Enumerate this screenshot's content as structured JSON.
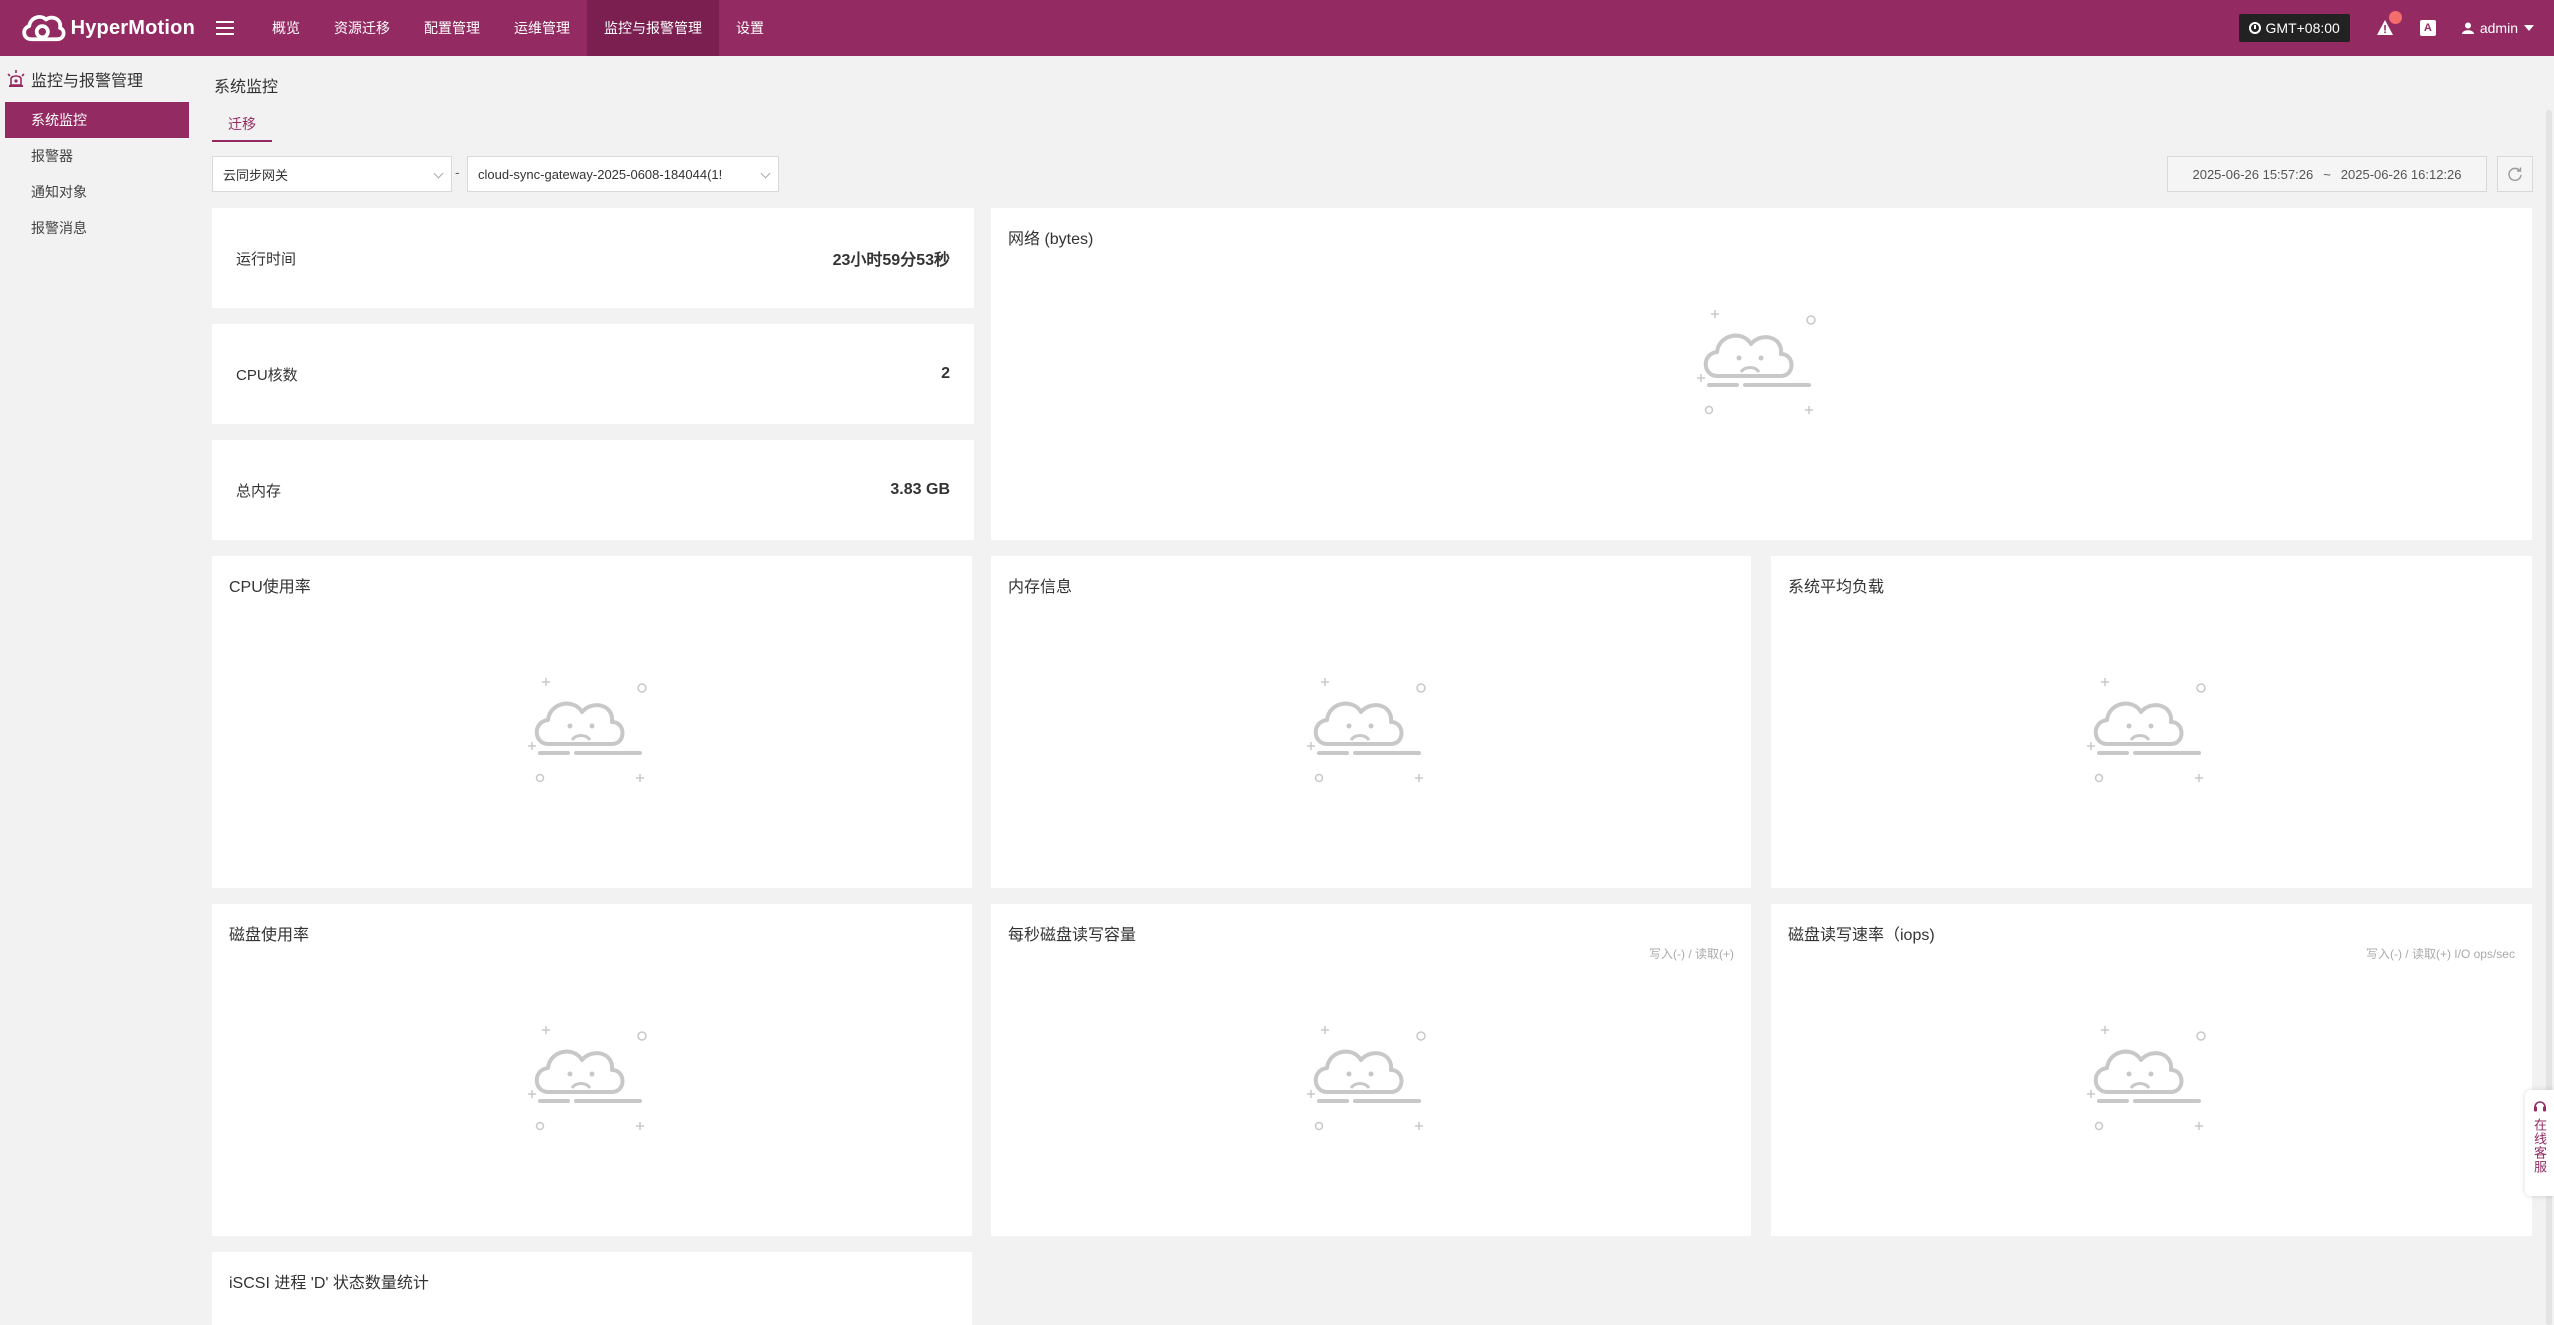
{
  "app": {
    "name": "HyperMotion"
  },
  "nav": [
    {
      "label": "概览"
    },
    {
      "label": "资源迁移"
    },
    {
      "label": "配置管理"
    },
    {
      "label": "运维管理"
    },
    {
      "label": "监控与报警管理",
      "active": true
    },
    {
      "label": "设置"
    }
  ],
  "topbar": {
    "timezone": "GMT+08:00",
    "alert_count": "",
    "user": "admin"
  },
  "sidebar": {
    "title": "监控与报警管理",
    "items": [
      {
        "label": "系统监控",
        "active": true
      },
      {
        "label": "报警器"
      },
      {
        "label": "通知对象"
      },
      {
        "label": "报警消息"
      }
    ]
  },
  "page": {
    "title": "系统监控",
    "tab": "迁移"
  },
  "filters": {
    "type": "云同步网关",
    "separator": "-",
    "instance": "cloud-sync-gateway-2025-0608-184044(1!",
    "start": "2025-06-26 15:57:26",
    "range_sep": "~",
    "end": "2025-06-26 16:12:26"
  },
  "stats": [
    {
      "label": "运行时间",
      "value": "23小时59分53秒"
    },
    {
      "label": "CPU核数",
      "value": "2"
    },
    {
      "label": "总内存",
      "value": "3.83 GB"
    }
  ],
  "charts": {
    "network": {
      "title": "网络 (bytes)"
    },
    "cpu": {
      "title": "CPU使用率"
    },
    "memory": {
      "title": "内存信息"
    },
    "load": {
      "title": "系统平均负载"
    },
    "disk": {
      "title": "磁盘使用率"
    },
    "disk_rw": {
      "title": "每秒磁盘读写容量",
      "legend": "写入(-) / 读取(+)"
    },
    "disk_iops": {
      "title": "磁盘读写速率（iops)",
      "legend": "写入(-) / 读取(+) I/O ops/sec"
    },
    "iscsi": {
      "title": "iSCSI 进程 'D' 状态数量统计"
    }
  },
  "customer_service": {
    "label": "在线客服"
  },
  "colors": {
    "brand": "#932b62",
    "brand_dark": "#7a1f50"
  }
}
